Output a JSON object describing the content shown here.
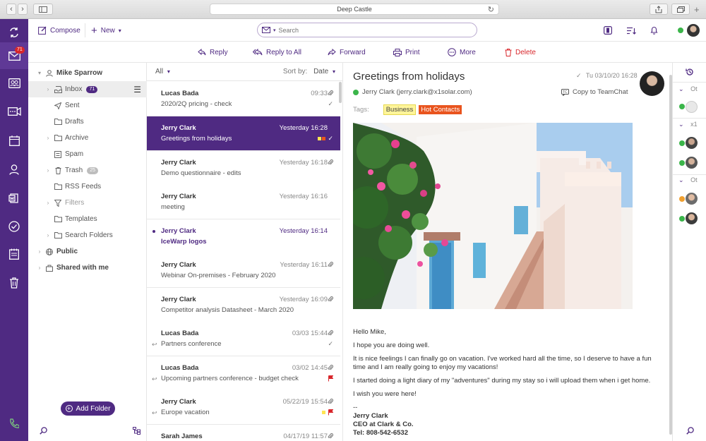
{
  "window": {
    "title": "Deep Castle"
  },
  "toolbar": {
    "compose_label": "Compose",
    "new_label": "New",
    "search_placeholder": "Search"
  },
  "rail": {
    "inbox_badge": "71"
  },
  "actions": {
    "reply": "Reply",
    "reply_all": "Reply to All",
    "forward": "Forward",
    "print": "Print",
    "more": "More",
    "delete": "Delete"
  },
  "folders": {
    "account": "Mike Sparrow",
    "inbox": "Inbox",
    "inbox_count": "71",
    "sent": "Sent",
    "drafts": "Drafts",
    "archive": "Archive",
    "spam": "Spam",
    "trash": "Trash",
    "trash_count": "25",
    "rss": "RSS Feeds",
    "filters": "Filters",
    "templates": "Templates",
    "search_folders": "Search Folders",
    "public": "Public",
    "shared": "Shared with me",
    "add_folder": "Add Folder"
  },
  "list": {
    "filter": "All",
    "sort_label": "Sort by:",
    "sort_value": "Date",
    "messages": [
      {
        "from": "Lucas Bada",
        "time": "09:33",
        "subject": "2020/2Q pricing - check"
      },
      {
        "from": "Jerry Clark",
        "time": "Yesterday 16:28",
        "subject": "Greetings from holidays"
      },
      {
        "from": "Jerry Clark",
        "time": "Yesterday 16:18",
        "subject": "Demo questionnaire - edits"
      },
      {
        "from": "Jerry Clark",
        "time": "Yesterday 16:16",
        "subject": "meeting"
      },
      {
        "from": "Jerry Clark",
        "time": "Yesterday 16:14",
        "subject": "IceWarp logos"
      },
      {
        "from": "Jerry Clark",
        "time": "Yesterday 16:11",
        "subject": "Webinar On-premises - February 2020"
      },
      {
        "from": "Jerry Clark",
        "time": "Yesterday 16:09",
        "subject": "Competitor analysis Datasheet - March 2020"
      },
      {
        "from": "Lucas Bada",
        "time": "03/03 15:44",
        "subject": "Partners conference"
      },
      {
        "from": "Lucas Bada",
        "time": "03/02 14:45",
        "subject": "Upcoming partners conference - budget check"
      },
      {
        "from": "Jerry Clark",
        "time": "05/22/19 15:54",
        "subject": "Europe vacation"
      },
      {
        "from": "Sarah James",
        "time": "04/17/19 11:57",
        "subject": ""
      }
    ]
  },
  "reader": {
    "subject": "Greetings from holidays",
    "date": "Tu 03/10/20 16:28",
    "sender": "Jerry Clark (jerry.clark@x1solar.com)",
    "copy_label": "Copy to TeamChat",
    "tags_label": "Tags:",
    "tag1": "Business",
    "tag2": "Hot Contacts",
    "greeting": "Hello Mike,",
    "p1": "I hope you are doing well.",
    "p2": "It is nice feelings I can finally go on vacation. I've worked hard all the time, so I deserve to have a fun time and I am really going to enjoy my vacations!",
    "p3": "I started doing a light diary of my \"adventures\" during my stay so i will upload them when i get home.",
    "p4": "I wish you were here!",
    "sig_dash": "--",
    "sig_name": "Jerry Clark",
    "sig_title": "CEO at Clark & Co.",
    "sig_tel": "Tel: 808-542-6532"
  },
  "contacts": {
    "group1": "Ot",
    "group2": "x1",
    "group3": "Ot"
  },
  "colors": {
    "brand": "#4f2a82",
    "rail": "#4f2a82",
    "delete": "#d8262b",
    "online": "#3bb54a",
    "away": "#f0a030"
  }
}
